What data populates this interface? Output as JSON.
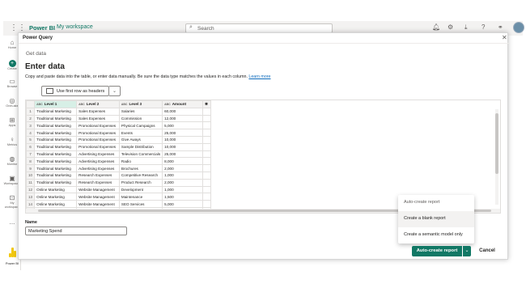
{
  "topbar": {
    "brand": "Power BI",
    "workspace": "My workspace",
    "search_placeholder": "Search",
    "icons": [
      "notification-icon",
      "settings-icon",
      "download-icon",
      "help-icon",
      "share-icon"
    ]
  },
  "leftnav": {
    "items": [
      {
        "label": "Home",
        "icon": "home-icon"
      },
      {
        "label": "Create",
        "icon": "create-icon"
      },
      {
        "label": "Browse",
        "icon": "browse-icon"
      },
      {
        "label": "OneLake",
        "icon": "onelake-icon"
      },
      {
        "label": "Apps",
        "icon": "apps-icon"
      },
      {
        "label": "Metrics",
        "icon": "metrics-icon"
      },
      {
        "label": "Monitor",
        "icon": "monitor-icon"
      },
      {
        "label": "Workspaces",
        "icon": "workspaces-icon"
      },
      {
        "label": "My workspace",
        "icon": "my-workspace-icon"
      },
      {
        "label": "...",
        "icon": "more-icon"
      }
    ],
    "footer_label": "Power BI"
  },
  "dialog": {
    "title": "Power Query",
    "breadcrumb": "Get data",
    "heading": "Enter data",
    "subtitle": "Copy and paste data into the table, or enter data manually. Be sure the data type matches the values in each column.",
    "learn_more": "Learn more",
    "headers_button": "Use first row as headers",
    "table": {
      "type_badge": "ABC",
      "columns": [
        "Level 1",
        "Level 2",
        "Level 3",
        "Amount"
      ],
      "rows": [
        [
          "1",
          "Traditional Marketing",
          "Sales Expenses",
          "Salaries",
          "60,000"
        ],
        [
          "2",
          "Traditional Marketing",
          "Sales Expenses",
          "Commission",
          "12,000"
        ],
        [
          "3",
          "Traditional Marketing",
          "Promotional Expenses",
          "Physical Campaigns",
          "5,000"
        ],
        [
          "4",
          "Traditional Marketing",
          "Promotional Expenses",
          "Events",
          "25,000"
        ],
        [
          "5",
          "Traditional Marketing",
          "Promotional Expenses",
          "Give Aways",
          "10,000"
        ],
        [
          "6",
          "Traditional Marketing",
          "Promotional Expenses",
          "Sample Distribution",
          "10,000"
        ],
        [
          "7",
          "Traditional Marketing",
          "Advertising Expenses",
          "Television Commercials",
          "25,000"
        ],
        [
          "8",
          "Traditional Marketing",
          "Advertising Expenses",
          "Radio",
          "8,000"
        ],
        [
          "9",
          "Traditional Marketing",
          "Advertising Expenses",
          "Brochures",
          "2,000"
        ],
        [
          "10",
          "Traditional Marketing",
          "Research Expenses",
          "Competitive Research",
          "1,000"
        ],
        [
          "11",
          "Traditional Marketing",
          "Research Expenses",
          "Product Research",
          "2,000"
        ],
        [
          "12",
          "Online Marketing",
          "Website Management",
          "Development",
          "1,000"
        ],
        [
          "13",
          "Online Marketing",
          "Website Management",
          "Maintenance",
          "1,500"
        ],
        [
          "14",
          "Online Marketing",
          "Website Management",
          "SEO Services",
          "5,000"
        ],
        [
          "15",
          "Online Marketing",
          "Content Creation Exp...",
          "Audio",
          "1,500"
        ]
      ]
    },
    "name_label": "Name",
    "name_value": "Marketing Spend",
    "menu": {
      "items": [
        "Auto-create report",
        "Create a blank report",
        "Create a semantic model only"
      ]
    },
    "primary_button": "Auto-create report",
    "cancel_button": "Cancel"
  },
  "colors": {
    "accent": "#117865",
    "selected_column": "#d7efe6"
  }
}
